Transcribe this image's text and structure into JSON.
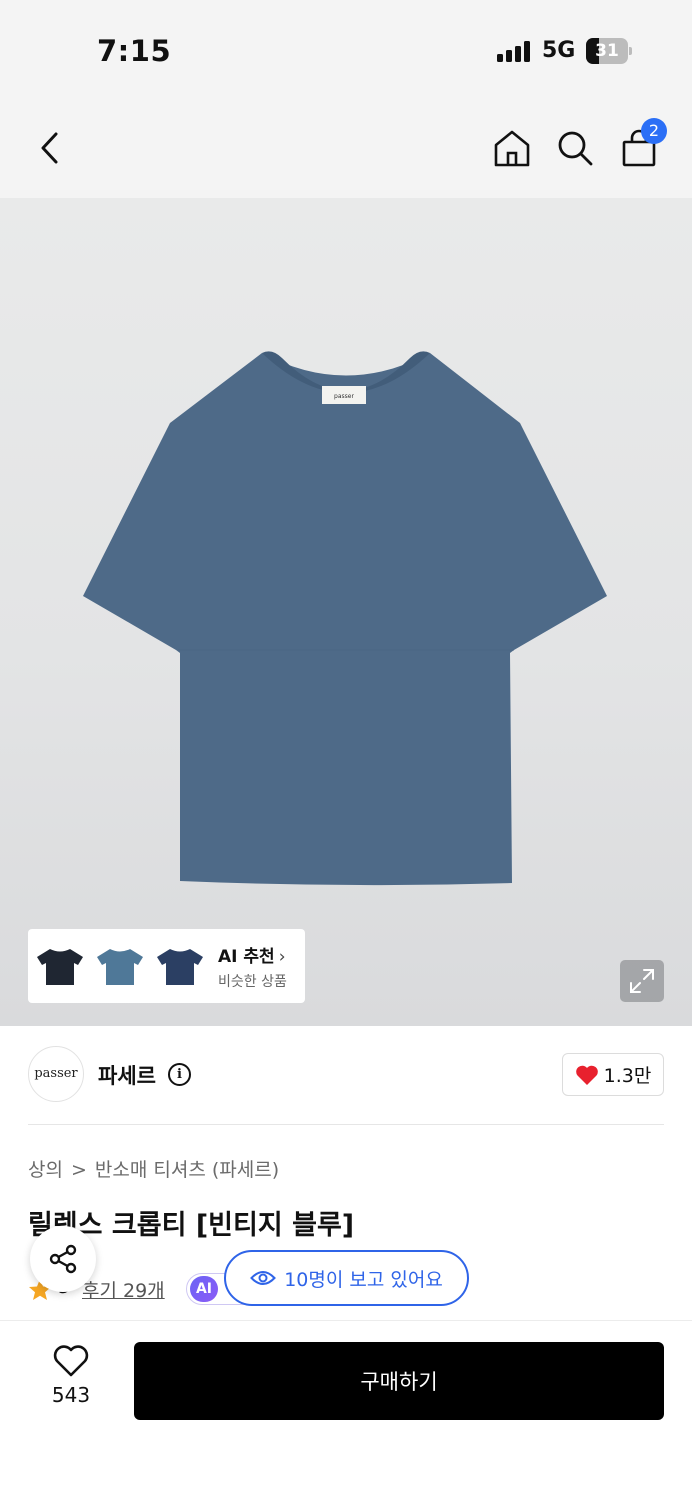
{
  "status_bar": {
    "time": "7:15",
    "network": "5G",
    "battery_level": "31"
  },
  "header": {
    "cart_count": "2",
    "icons": [
      "back-icon",
      "home-icon",
      "search-icon",
      "shopping-bag-icon"
    ]
  },
  "product_image": {
    "tshirt_color": "#4e6a88",
    "label_text": "passer"
  },
  "ai_recommend": {
    "title": "AI 추천",
    "chevron": "›",
    "subtitle": "비슷한 상품",
    "thumbnail_colors": [
      "#1f2632",
      "#4f7898",
      "#2b3f63"
    ]
  },
  "brand": {
    "logo_text": "passer",
    "name": "파세르",
    "info_glyph": "i",
    "like_count": "1.3만"
  },
  "breadcrumb": {
    "items": [
      "상의",
      "반소매 티셔츠 (파세르)"
    ],
    "separator": ">"
  },
  "product": {
    "title": "릴렉스 크롭티 [빈티지 블루]"
  },
  "rating": {
    "value": "5",
    "reviews_label": "후기 29개",
    "ai_badge": "AI"
  },
  "viewers": {
    "text": "10명이 보고 있어요"
  },
  "bottom_bar": {
    "wish_count": "543",
    "buy_label": "구매하기"
  },
  "colors": {
    "accent_blue": "#2f64e8",
    "badge_blue": "#2b6ff6",
    "heart_red": "#e8212e",
    "star_orange": "#f5a623",
    "buy_button": "#000000"
  }
}
